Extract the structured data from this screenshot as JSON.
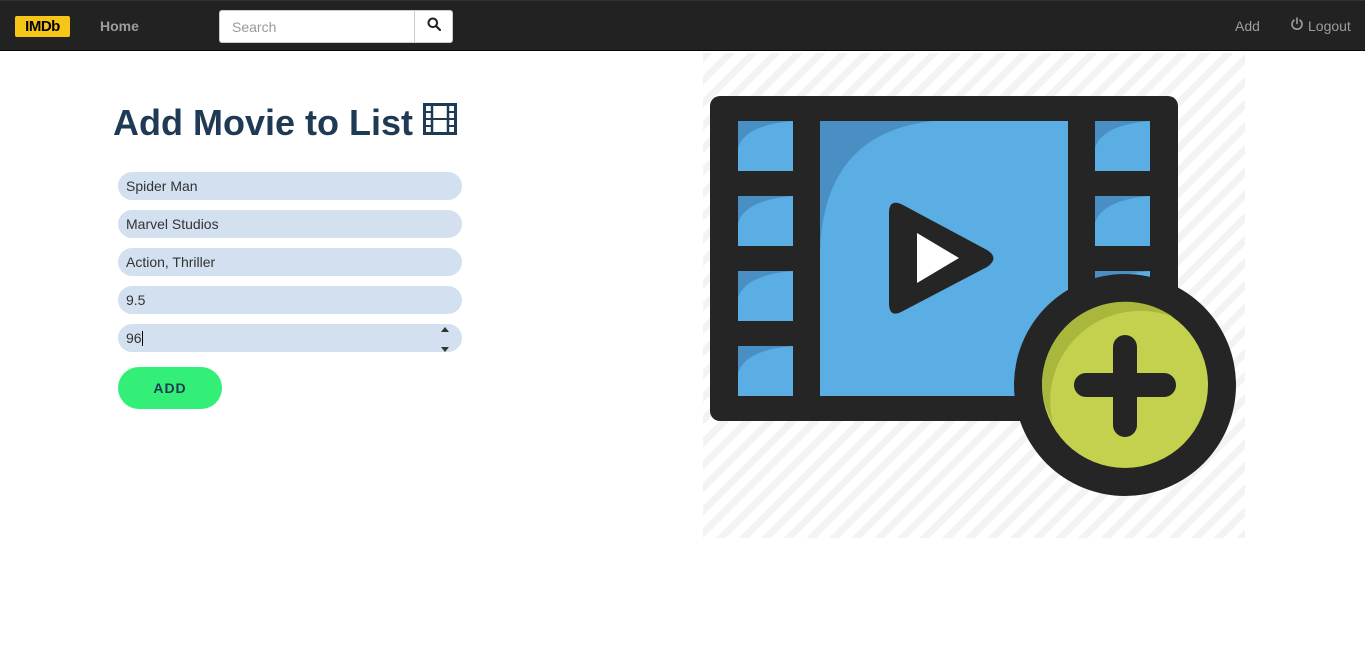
{
  "nav": {
    "logo_text": "IMDb",
    "home_label": "Home",
    "search_placeholder": "Search",
    "add_label": "Add",
    "logout_label": "Logout"
  },
  "form": {
    "title": "Add Movie to List",
    "title_icon": "film-frames-icon",
    "fields": [
      {
        "value": "Spider Man"
      },
      {
        "value": "Marvel Studios"
      },
      {
        "value": "Action, Thriller"
      },
      {
        "value": "9.5"
      },
      {
        "value": "96"
      }
    ],
    "submit_label": "ADD"
  },
  "colors": {
    "nav_bg": "#222222",
    "logo_bg": "#f5c518",
    "title": "#1f3a55",
    "field_bg": "#d3e0ef",
    "button_bg": "#33ee77",
    "film_blue": "#5aaee3",
    "plus_green": "#c3d14e"
  },
  "illustration": {
    "icon": "add-video-icon"
  }
}
